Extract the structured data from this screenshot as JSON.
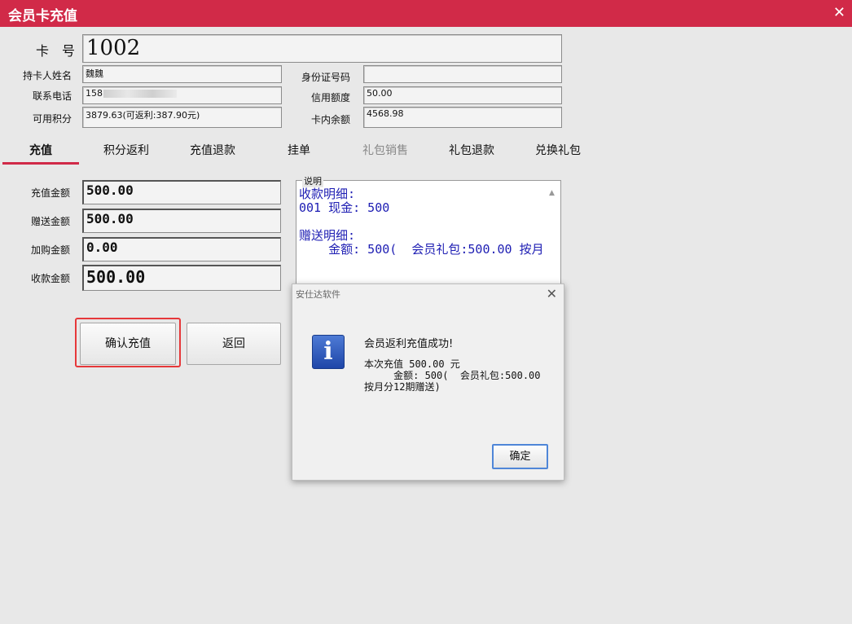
{
  "window": {
    "title": "会员卡充值",
    "close_glyph": "✕"
  },
  "card": {
    "card_no_label": "卡　号",
    "card_no": "1002",
    "holder_name_label": "持卡人姓名",
    "holder_name": "魏魏",
    "phone_label": "联系电话",
    "phone_prefix": "158",
    "points_label": "可用积分",
    "points": "3879.63(可返利:387.90元)",
    "id_label": "身份证号码",
    "id_value": "",
    "credit_label": "信用额度",
    "credit": "50.00",
    "balance_label": "卡内余额",
    "balance": "4568.98"
  },
  "tabs": [
    {
      "label": "充值",
      "active": true,
      "disabled": false
    },
    {
      "label": "积分返利",
      "active": false,
      "disabled": false
    },
    {
      "label": "充值退款",
      "active": false,
      "disabled": false
    },
    {
      "label": "挂单",
      "active": false,
      "disabled": false
    },
    {
      "label": "礼包销售",
      "active": false,
      "disabled": true
    },
    {
      "label": "礼包退款",
      "active": false,
      "disabled": false
    },
    {
      "label": "兑换礼包",
      "active": false,
      "disabled": false
    }
  ],
  "form": {
    "recharge_label": "充值金额",
    "recharge": "500.00",
    "gift_label": "赠送金额",
    "gift": "500.00",
    "addbuy_label": "加购金额",
    "addbuy": "0.00",
    "collect_label": "收款金额",
    "collect": "500.00"
  },
  "description": {
    "legend": "说明",
    "text": "收款明细:\n001 现金: 500\n\n赠送明细:\n    金额: 500(  会员礼包:500.00 按月"
  },
  "buttons": {
    "confirm": "确认充值",
    "back": "返回"
  },
  "dialog": {
    "title": "安仕达软件",
    "close_glyph": "✕",
    "icon": "info-icon",
    "message_title": "会员返利充值成功!",
    "line1": "本次充值 500.00 元",
    "line2": "     金额: 500(  会员礼包:500.00",
    "line3": "按月分12期赠送)",
    "ok": "确定"
  },
  "colors": {
    "accent": "#d12a48",
    "desc_text": "#1d1db3",
    "focus": "#e6383a"
  }
}
